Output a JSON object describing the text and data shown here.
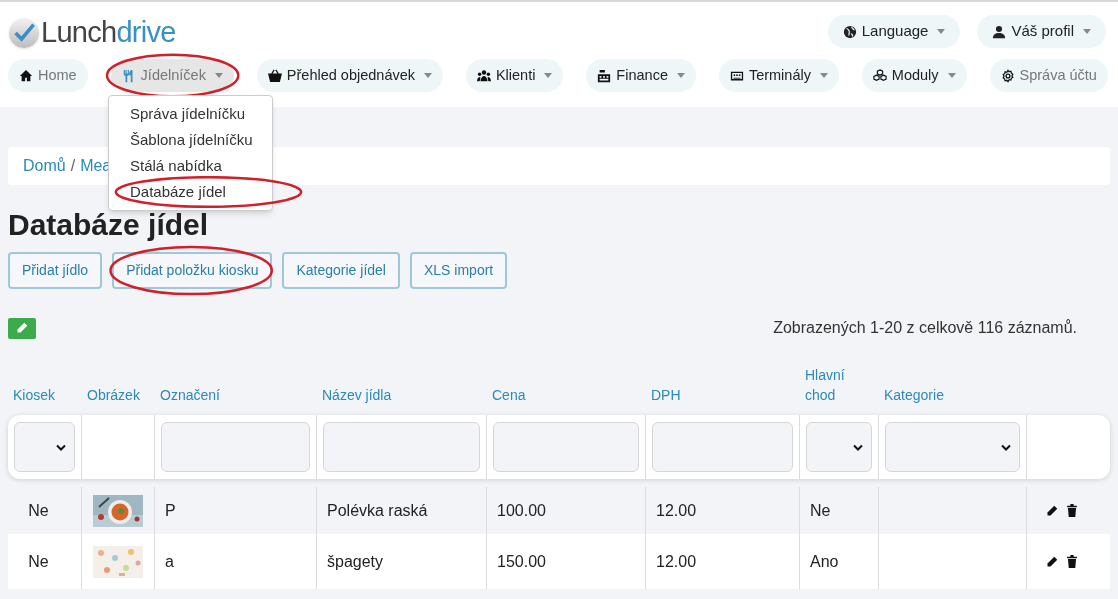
{
  "logo": {
    "text_start": "Lunch",
    "text_end": "drive"
  },
  "top_menu": [
    {
      "label": "Language"
    },
    {
      "label": "Váš profil"
    }
  ],
  "nav": [
    {
      "label": "Home",
      "selected": false,
      "caret": false,
      "circled": false,
      "muted": true
    },
    {
      "label": "Jídelníček",
      "selected": true,
      "caret": true,
      "circled": true,
      "muted": true
    },
    {
      "label": "Přehled objednávek",
      "selected": false,
      "caret": true,
      "circled": false,
      "muted": false
    },
    {
      "label": "Klienti",
      "selected": false,
      "caret": true,
      "circled": false,
      "muted": false
    },
    {
      "label": "Finance",
      "selected": false,
      "caret": true,
      "circled": false,
      "muted": false
    },
    {
      "label": "Terminály",
      "selected": false,
      "caret": true,
      "circled": false,
      "muted": false
    },
    {
      "label": "Moduly",
      "selected": false,
      "caret": true,
      "circled": false,
      "muted": false
    },
    {
      "label": "Správa účtu",
      "selected": false,
      "caret": false,
      "circled": false,
      "muted": true
    }
  ],
  "dropdown": [
    {
      "label": "Správa jídelníčku",
      "circled": false
    },
    {
      "label": "Šablona jídelníčku",
      "circled": false
    },
    {
      "label": "Stálá nabídka",
      "circled": false
    },
    {
      "label": "Databáze jídel",
      "circled": true
    }
  ],
  "breadcrumb": {
    "home": "Domů",
    "separator": "/",
    "current": "Mea"
  },
  "title": "Databáze jídel",
  "actions": [
    {
      "label": "Přidat jídlo",
      "circled": false
    },
    {
      "label": "Přidat položku kiosku",
      "circled": true
    },
    {
      "label": "Kategorie jídel",
      "circled": false
    },
    {
      "label": "XLS import",
      "circled": false
    }
  ],
  "summary": "Zobrazených 1-20 z celkově 116 záznamů.",
  "table": {
    "columns": [
      {
        "label": "Kiosek",
        "kind": "select"
      },
      {
        "label": "Obrázek",
        "kind": "none"
      },
      {
        "label": "Označení",
        "kind": "input"
      },
      {
        "label": "Název jídla",
        "kind": "input"
      },
      {
        "label": "Cena",
        "kind": "input"
      },
      {
        "label": "DPH",
        "kind": "input"
      },
      {
        "label": "Hlavní chod",
        "kind": "select"
      },
      {
        "label": "Kategorie",
        "kind": "select"
      },
      {
        "kind": "none"
      }
    ],
    "rows": [
      {
        "kiosek": "Ne",
        "code": "P",
        "name": "Polévka raská",
        "price": "100.00",
        "vat": "12.00",
        "main": "Ne",
        "category": ""
      },
      {
        "kiosek": "Ne",
        "code": "a",
        "name": "špagety",
        "price": "150.00",
        "vat": "12.00",
        "main": "Ano",
        "category": ""
      }
    ]
  }
}
